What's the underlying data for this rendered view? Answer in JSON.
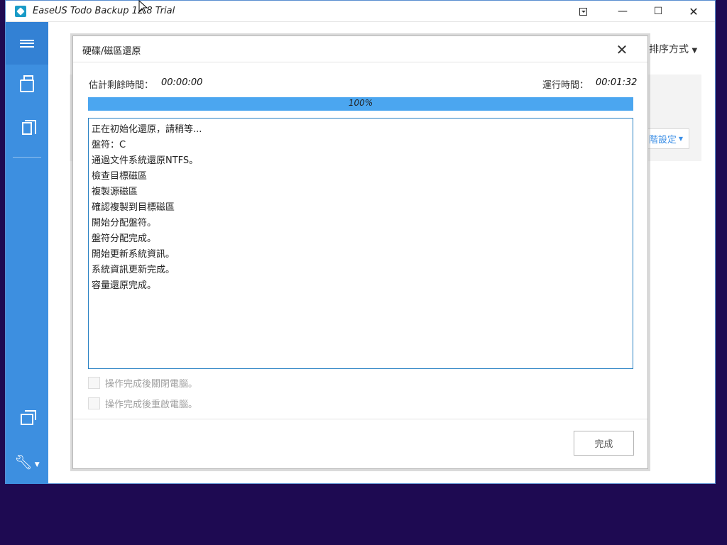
{
  "window": {
    "title": "EaseUS Todo Backup 12.8 Trial",
    "minimize_glyph": "—",
    "maximize_glyph": "☐",
    "close_glyph": "✕"
  },
  "sidebar": {
    "icons": [
      "menu-icon",
      "backup-icon",
      "clone-icon",
      "window-icon",
      "tools-icon"
    ],
    "accent": "#3d8fe0"
  },
  "background": {
    "sort_label": "排序方式",
    "advanced_settings": "階設定"
  },
  "dialog": {
    "title": "硬碟/磁區還原",
    "close_glyph": "✕",
    "remaining_label": "估計剩餘時間：",
    "remaining_value": "00:00:00",
    "elapsed_label": "運行時間：",
    "elapsed_value": "00:01:32",
    "progress_percent": 100,
    "progress_text": "100%",
    "log": [
      "正在初始化還原，請稍等...",
      "盤符：C",
      "通過文件系統還原NTFS。",
      "檢查目標磁區",
      "複製源磁區",
      "確認複製到目標磁區",
      "開始分配盤符。",
      "盤符分配完成。",
      "開始更新系統資訊。",
      "系統資訊更新完成。",
      "容量還原完成。"
    ],
    "shutdown_label": "操作完成後關閉電腦。",
    "restart_label": "操作完成後重啟電腦。",
    "finish_label": "完成"
  }
}
